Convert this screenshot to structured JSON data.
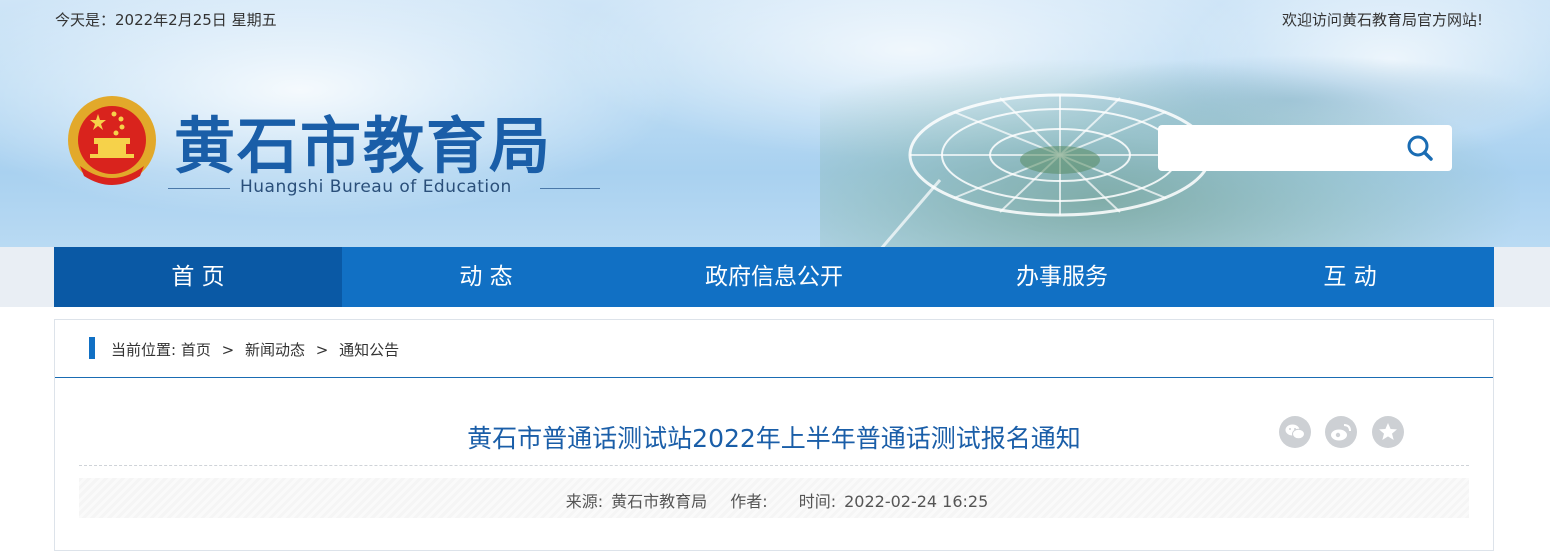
{
  "header": {
    "date": "今天是：2022年2月25日 星期五",
    "welcome": "欢迎访问黄石教育局官方网站!",
    "site_title": "黄石市教育局",
    "site_subtitle_en": "Huangshi Bureau of Education",
    "search": {
      "placeholder": "",
      "icon": "search-icon"
    }
  },
  "nav": {
    "items": [
      {
        "label": "首  页",
        "active": true
      },
      {
        "label": "动  态"
      },
      {
        "label": "政府信息公开"
      },
      {
        "label": "办事服务"
      },
      {
        "label": "互  动"
      }
    ]
  },
  "breadcrumb": {
    "prefix": "当前位置:",
    "items": [
      "首页",
      "新闻动态",
      "通知公告"
    ],
    "separator": ">"
  },
  "article": {
    "title": "黄石市普通话测试站2022年上半年普通话测试报名通知",
    "source_label": "来源:",
    "source": "黄石市教育局",
    "author_label": "作者:",
    "author": "",
    "time_label": "时间:",
    "time": "2022-02-24 16:25",
    "share_icons": [
      "wechat-icon",
      "weibo-icon",
      "favorite-star-icon"
    ]
  },
  "colors": {
    "nav_bg": "#1170c4",
    "nav_active": "#0a59a5",
    "title_blue": "#1a5ea8",
    "share_icon_bg": "#cdd0d4"
  }
}
